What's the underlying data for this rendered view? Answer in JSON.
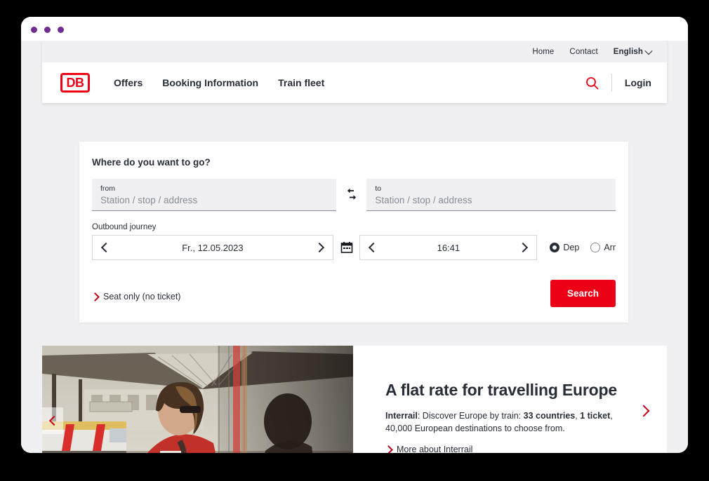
{
  "window": {
    "dots_color": "#6f2d91",
    "dot_count": 3
  },
  "header": {
    "meta": [
      {
        "label": "Home"
      },
      {
        "label": "Contact"
      }
    ],
    "language": "English",
    "logo_text": "DB",
    "logo_color": "#ec0016",
    "nav": [
      {
        "label": "Offers"
      },
      {
        "label": "Booking Information"
      },
      {
        "label": "Train fleet"
      }
    ],
    "search_icon": "search-icon",
    "login_label": "Login"
  },
  "search_card": {
    "title": "Where do you want to go?",
    "from": {
      "label": "from",
      "placeholder": "Station / stop / address",
      "value": ""
    },
    "to": {
      "label": "to",
      "placeholder": "Station / stop / address",
      "value": ""
    },
    "swap_icon": "swap-arrows-icon",
    "journey_label": "Outbound journey",
    "date": {
      "value": "Fr., 12.05.2023",
      "prev_icon": "chevron-left-icon",
      "next_icon": "chevron-right-icon"
    },
    "calendar_icon": "calendar-icon",
    "time": {
      "value": "16:41",
      "prev_icon": "chevron-left-icon",
      "next_icon": "chevron-right-icon"
    },
    "radios": [
      {
        "label": "Dep",
        "selected": true
      },
      {
        "label": "Arr",
        "selected": false
      }
    ],
    "seat_only_link": "Seat only (no ticket)",
    "search_button": "Search",
    "accent_color": "#ec0016"
  },
  "promo": {
    "image_alt": "woman-at-train-station-photo",
    "title": "A flat rate for travelling Europe",
    "body_lead": "Interrail",
    "body_part1": ": Discover Europe by train: ",
    "body_bold1": "33 countries",
    "body_part2": ", ",
    "body_bold2": "1 ticket",
    "body_part3": ", 40,000 European destinations to choose from.",
    "more_link": "More about Interrail",
    "prev_icon": "carousel-prev-icon",
    "next_icon": "carousel-next-icon"
  }
}
